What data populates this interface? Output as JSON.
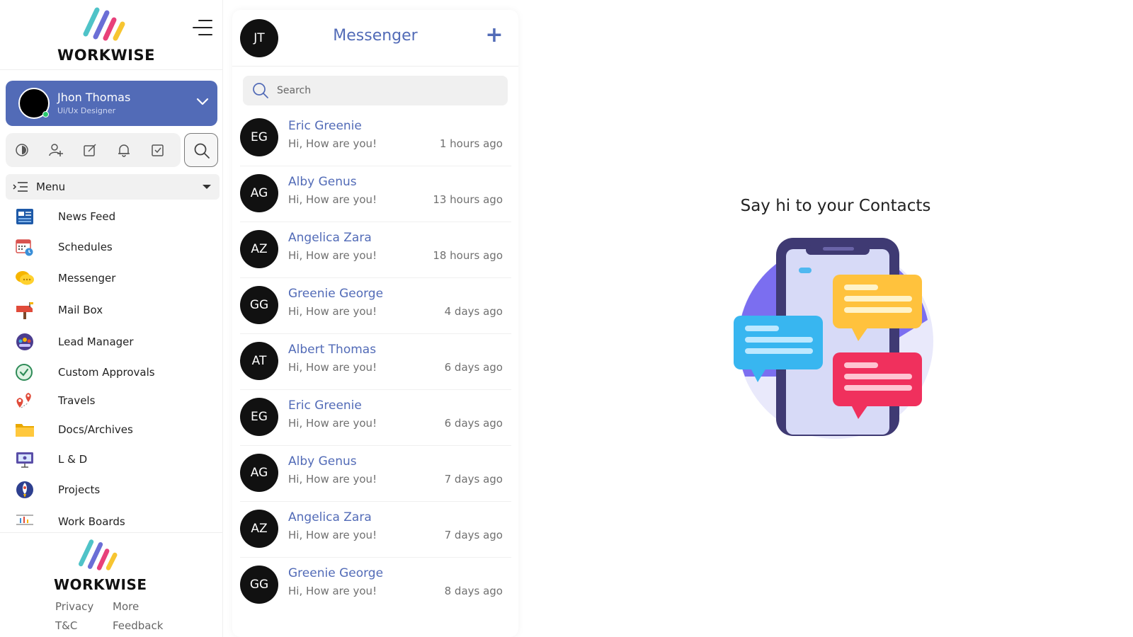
{
  "brand": {
    "name": "WORKWISE"
  },
  "user": {
    "name": "Jhon Thomas",
    "role": "Ui/Ux Designer"
  },
  "quickbar": {
    "icons": [
      "theme-contrast-icon",
      "add-user-icon",
      "edit-task-icon",
      "bell-icon",
      "checkbox-icon"
    ],
    "search_icon": "search-icon"
  },
  "menu": {
    "label": "Menu",
    "items": [
      {
        "label": "News Feed",
        "icon": "newspaper-icon"
      },
      {
        "label": "Schedules",
        "icon": "calendar-icon"
      },
      {
        "label": "Messenger",
        "icon": "chat-bubbles-icon"
      },
      {
        "label": "Mail Box",
        "icon": "mailbox-icon"
      },
      {
        "label": "Lead Manager",
        "icon": "team-icon"
      },
      {
        "label": "Custom Approvals",
        "icon": "approval-check-icon"
      },
      {
        "label": "Travels",
        "icon": "map-pin-icon"
      },
      {
        "label": "Docs/Archives",
        "icon": "folder-icon"
      },
      {
        "label": "L & D",
        "icon": "presentation-board-icon"
      },
      {
        "label": "Projects",
        "icon": "rocket-icon"
      },
      {
        "label": "Work Boards",
        "icon": "board-chart-icon"
      }
    ]
  },
  "footer": {
    "privacy": "Privacy",
    "more": "More",
    "tnc": "T&C",
    "feedback": "Feedback"
  },
  "messenger": {
    "avatar_initials": "JT",
    "title": "Messenger",
    "add_label": "+",
    "search_placeholder": "Search",
    "conversations": [
      {
        "initials": "EG",
        "name": "Eric Greenie",
        "message": "Hi, How are you!",
        "time": "1 hours ago"
      },
      {
        "initials": "AG",
        "name": "Alby Genus",
        "message": "Hi, How are you!",
        "time": "13 hours ago"
      },
      {
        "initials": "AZ",
        "name": "Angelica Zara",
        "message": "Hi, How are you!",
        "time": "18 hours ago"
      },
      {
        "initials": "GG",
        "name": "Greenie George",
        "message": "Hi, How are you!",
        "time": "4 days ago"
      },
      {
        "initials": "AT",
        "name": "Albert Thomas",
        "message": "Hi, How are you!",
        "time": "6 days ago"
      },
      {
        "initials": "EG",
        "name": "Eric Greenie",
        "message": "Hi, How are you!",
        "time": "6 days ago"
      },
      {
        "initials": "AG",
        "name": "Alby Genus",
        "message": "Hi, How are you!",
        "time": "7 days ago"
      },
      {
        "initials": "AZ",
        "name": "Angelica Zara",
        "message": "Hi, How are you!",
        "time": "7 days ago"
      },
      {
        "initials": "GG",
        "name": "Greenie George",
        "message": "Hi, How are you!",
        "time": "8 days ago"
      }
    ]
  },
  "empty_state": {
    "title": "Say hi to your Contacts",
    "illustration": "phone-chat-illustration"
  },
  "colors": {
    "accent": "#526bb7",
    "online": "#28c76f",
    "avatar": "#111111"
  }
}
